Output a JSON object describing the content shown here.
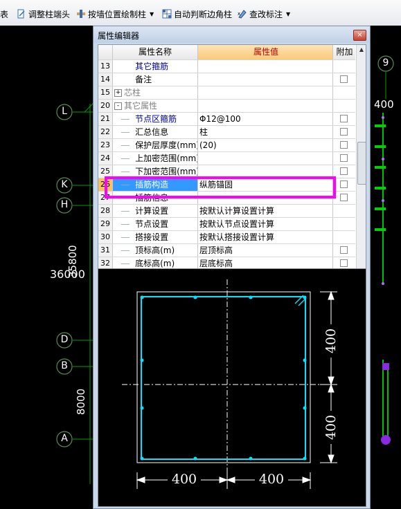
{
  "toolbar": {
    "items": [
      {
        "label": "表",
        "icon": "table-icon"
      },
      {
        "label": "调整柱端头",
        "icon": "adjust-column-end-icon"
      },
      {
        "label": "按墙位置绘制柱",
        "icon": "draw-column-by-wall-icon"
      },
      {
        "label": "自动判断边角柱",
        "icon": "auto-corner-column-icon"
      },
      {
        "label": "查改标注",
        "icon": "edit-annotation-icon"
      }
    ]
  },
  "axes": {
    "labels": [
      "L",
      "K",
      "H",
      "D",
      "B",
      "A",
      "9"
    ],
    "dims": [
      "36000",
      "35800",
      "8000",
      "400"
    ]
  },
  "dialog": {
    "title": "属性编辑器",
    "close": "×",
    "columns": {
      "name": "属性名称",
      "value": "属性值",
      "add": "附加"
    },
    "rows": [
      {
        "num": "13",
        "name": "其它箍筋",
        "value": "",
        "style": "blue",
        "checkbox": false,
        "indent": 1
      },
      {
        "num": "14",
        "name": "备注",
        "value": "",
        "style": "normal",
        "checkbox": true,
        "indent": 1
      },
      {
        "num": "15",
        "name": "芯柱",
        "value": "",
        "style": "gray",
        "checkbox": false,
        "group": "+"
      },
      {
        "num": "20",
        "name": "其它属性",
        "value": "",
        "style": "gray",
        "checkbox": false,
        "group": "-"
      },
      {
        "num": "21",
        "name": "节点区箍筋",
        "value": "Φ12@100",
        "style": "blue",
        "checkbox": true,
        "indent": 2
      },
      {
        "num": "22",
        "name": "汇总信息",
        "value": "柱",
        "style": "normal",
        "checkbox": true,
        "indent": 2
      },
      {
        "num": "23",
        "name": "保护层厚度(mm)",
        "value": "(20)",
        "style": "normal",
        "checkbox": true,
        "indent": 2
      },
      {
        "num": "24",
        "name": "上加密范围(mm)",
        "value": "",
        "style": "normal",
        "checkbox": true,
        "indent": 2
      },
      {
        "num": "25",
        "name": "下加密范围(mm)",
        "value": "",
        "style": "normal",
        "checkbox": true,
        "indent": 2
      },
      {
        "num": "26",
        "name": "插筋构造",
        "value": "纵筋锚固",
        "style": "selected",
        "checkbox": true,
        "indent": 2
      },
      {
        "num": "27",
        "name": "插筋信息",
        "value": "",
        "style": "normal",
        "checkbox": true,
        "indent": 2
      },
      {
        "num": "28",
        "name": "计算设置",
        "value": "按默认计算设置计算",
        "style": "normal",
        "checkbox": false,
        "indent": 2
      },
      {
        "num": "29",
        "name": "节点设置",
        "value": "按默认节点设置计算",
        "style": "normal",
        "checkbox": false,
        "indent": 2
      },
      {
        "num": "30",
        "name": "搭接设置",
        "value": "按默认搭接设置计算",
        "style": "normal",
        "checkbox": false,
        "indent": 2
      },
      {
        "num": "31",
        "name": "顶标高(m)",
        "value": "层顶标高",
        "style": "normal",
        "checkbox": true,
        "indent": 2
      },
      {
        "num": "32",
        "name": "底标高(m)",
        "value": "层底标高",
        "style": "normal",
        "checkbox": true,
        "indent": 2
      }
    ]
  },
  "preview": {
    "dim_bottom_left": "400",
    "dim_bottom_right": "400",
    "dim_right_top": "400",
    "dim_right_bottom": "400"
  },
  "colors": {
    "highlight": "#ff00ff",
    "rebar": "#00e5ff",
    "grid": "#00c000",
    "selection": "#3399ff"
  }
}
